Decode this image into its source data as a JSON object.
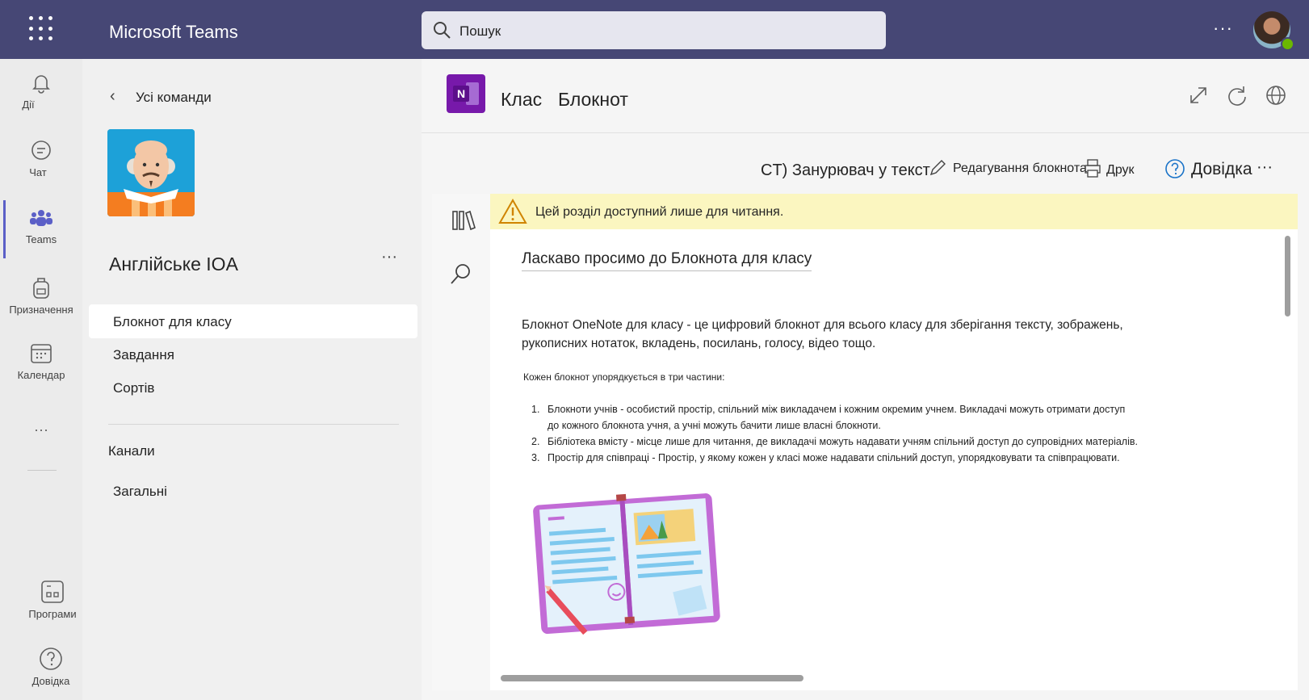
{
  "app": {
    "title": "Microsoft Teams"
  },
  "search": {
    "placeholder": "Пошук"
  },
  "topbar": {
    "more": "···"
  },
  "rail": {
    "items": [
      {
        "label": "Дії",
        "icon": "bell-icon"
      },
      {
        "label": "Чат",
        "icon": "chat-icon"
      },
      {
        "label": "Teams",
        "icon": "teams-icon"
      },
      {
        "label": "Призначення",
        "icon": "backpack-icon"
      },
      {
        "label": "Календар",
        "icon": "calendar-icon"
      },
      {
        "label": "···",
        "icon": "more-icon"
      },
      {
        "label": "Програми",
        "icon": "apps-icon"
      },
      {
        "label": "Довідка",
        "icon": "help-icon"
      }
    ],
    "active_color": "#5b5fc7"
  },
  "team": {
    "back_label": "Усі команди",
    "name": "Англійське IOA",
    "more": "···",
    "nav": [
      "Блокнот для класу",
      "Завдання",
      "Сортів"
    ],
    "channels_header": "Канали",
    "channels": [
      "Загальні"
    ]
  },
  "header": {
    "tab_class": "Клас",
    "tab_notebook": "Блокнот"
  },
  "ribbon": {
    "title": "CT) Занурювач у текст",
    "edit": "Редагування блокнота",
    "print": "Друк",
    "help": "Довідка",
    "more": "···"
  },
  "warning": {
    "text": "Цей розділ доступний лише для читання."
  },
  "page": {
    "title": "Ласкаво просимо до Блокнота для класу",
    "intro": "Блокнот OneNote для класу - це цифровий блокнот для всього класу для зберігання тексту, зображень, рукописних нотаток, вкладень, посилань, голосу, відео тощо.",
    "subhead": "Кожен блокнот упорядкується в три частини:",
    "list": [
      {
        "num": "1.",
        "text": "Блокноти учнів - особистий простір, спільний між викладачем і кожним окремим учнем. Викладачі можуть отримати доступ до кожного блокнота учня, а учні можуть бачити лише власні блокноти."
      },
      {
        "num": "2.",
        "text": "Бібліотека вмісту - місце лише для читання, де викладачі можуть надавати учням спільний доступ до супровідних матеріалів."
      },
      {
        "num": "3.",
        "text": "Простір для співпраці -    Простір, у якому кожен у класі може надавати спільний доступ, упорядковувати та співпрацювати."
      }
    ]
  },
  "colors": {
    "topbar": "#464775",
    "onenote": "#7719aa",
    "warning_bg": "#fbf6c0"
  }
}
